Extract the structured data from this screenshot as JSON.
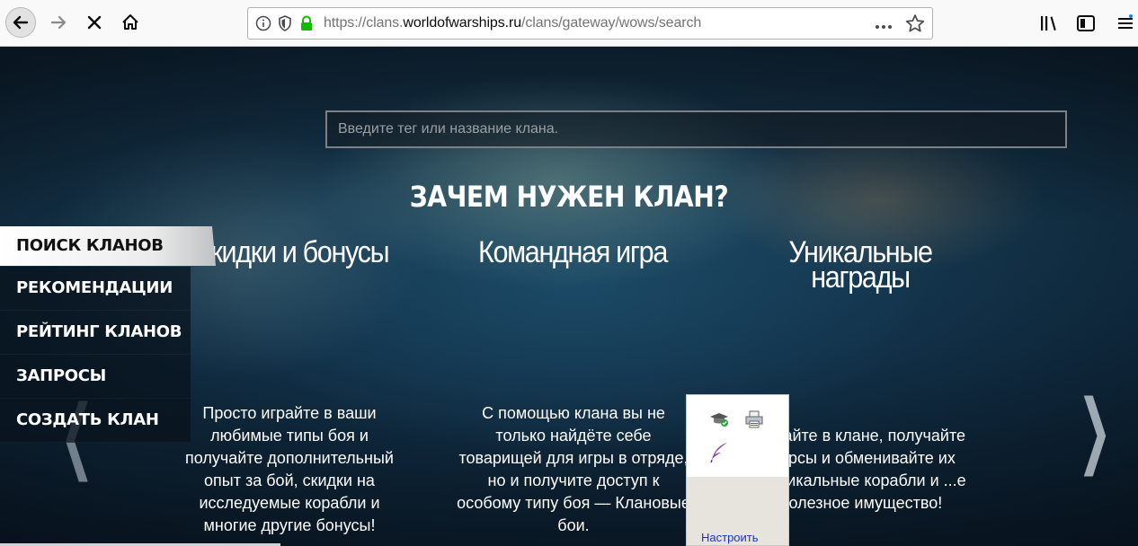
{
  "browser": {
    "url_prefix": "https://clans.",
    "url_domain": "worldofwarships.ru",
    "url_path": "/clans/gateway/wows/search",
    "more_icon": "ellipsis-icon",
    "bookmark_icon": "star-icon"
  },
  "search": {
    "placeholder": "Введите тег или название клана."
  },
  "heading": "ЗАЧЕМ НУЖЕН КЛАН?",
  "sidenav": {
    "items": [
      {
        "label": "ПОИСК КЛАНОВ",
        "active": true
      },
      {
        "label": "РЕКОМЕНДАЦИИ"
      },
      {
        "label": "РЕЙТИНГ КЛАНОВ"
      },
      {
        "label": "ЗАПРОСЫ"
      },
      {
        "label": "СОЗДАТЬ КЛАН"
      }
    ]
  },
  "columns": [
    {
      "title": "Скидки и бонусы",
      "text": "Просто играйте в ваши любимые типы боя и получайте дополнительный опыт за бой, скидки на исследуемые корабли и многие другие бонусы!"
    },
    {
      "title": "Командная игра",
      "text": "С помощью клана вы не только найдёте себе товарищей для игры в отряде, но и получите доступ к особому типу боя — Клановые бои."
    },
    {
      "title_line1": "Уникальные",
      "title_line2": "награды",
      "text": "Играйте в клане, получайте ...урсы и обменивайте их ...уникальные корабли и ...е полезное имущество!"
    }
  ],
  "popup": {
    "customize_label": "Настроить"
  }
}
